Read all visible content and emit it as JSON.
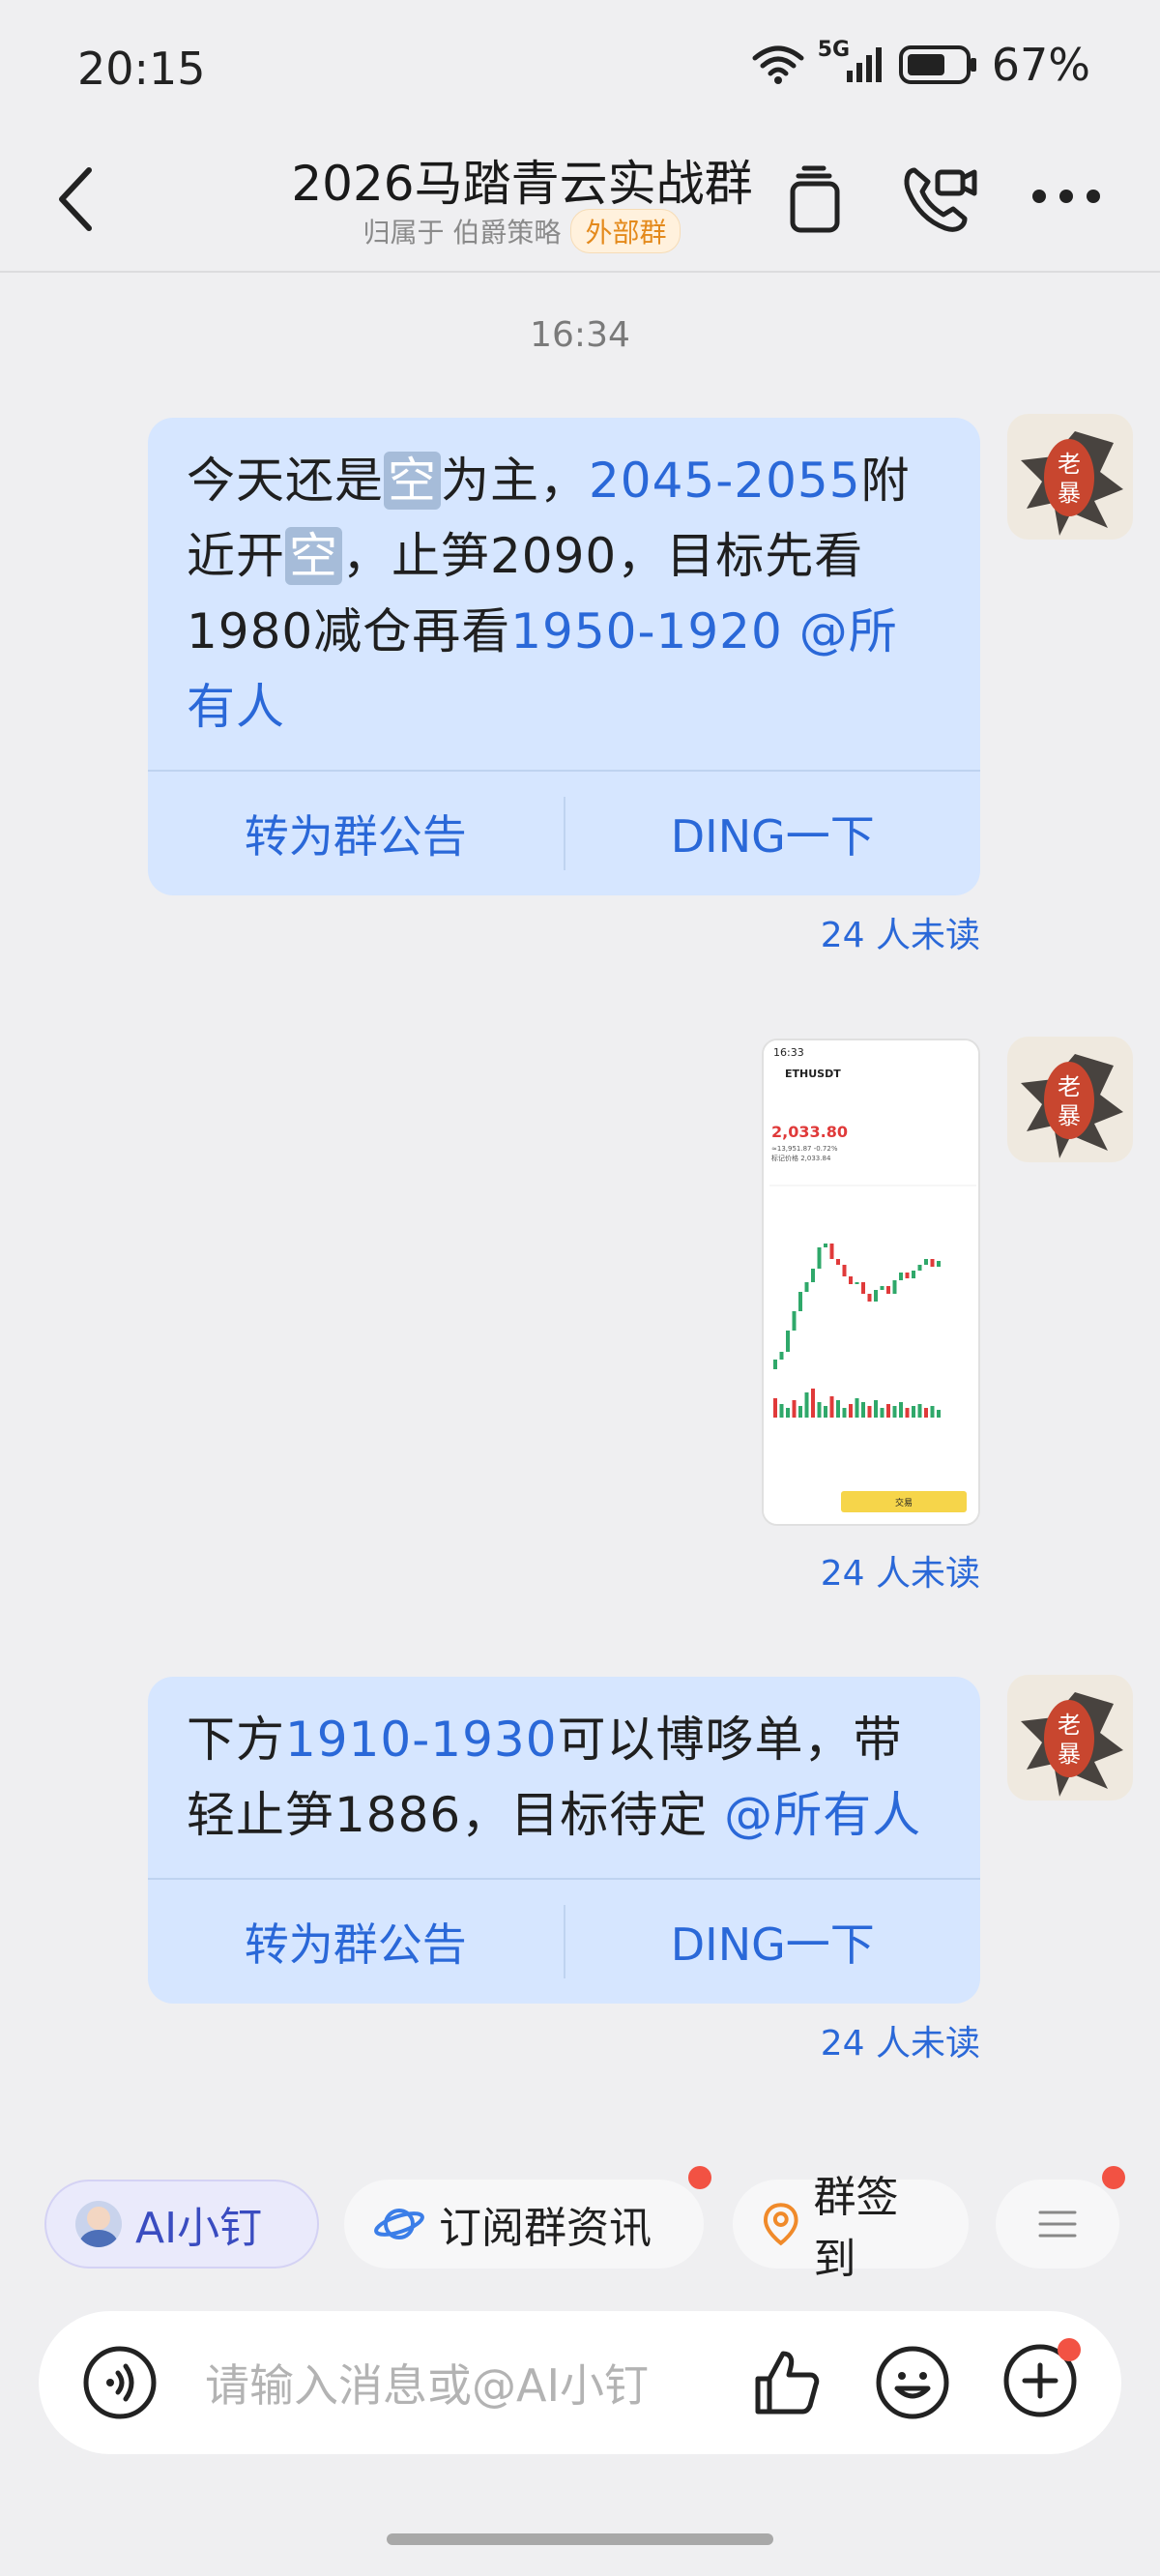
{
  "status_bar": {
    "time": "20:15",
    "network": "5G",
    "battery": "67%"
  },
  "header": {
    "title": "2026马踏青云实战群",
    "subtitle": "归属于 伯爵策略",
    "badge": "外部群",
    "icons": [
      "back-icon",
      "copy-icon",
      "video-call-icon",
      "more-icon"
    ]
  },
  "timestamp": "16:34",
  "messages": [
    {
      "segments": [
        {
          "t": "今天还是",
          "c": "n"
        },
        {
          "t": "空",
          "c": "tag"
        },
        {
          "t": "为主，",
          "c": "n"
        },
        {
          "t": "2045-2055",
          "c": "h"
        },
        {
          "t": "附近开",
          "c": "n"
        },
        {
          "t": "空",
          "c": "tag"
        },
        {
          "t": "，止笋2090，目标先看1980减仓再看",
          "c": "n"
        },
        {
          "t": "1950-1920",
          "c": "h"
        },
        {
          "t": " ",
          "c": "n"
        },
        {
          "t": "@所有人",
          "c": "h"
        }
      ],
      "action_left": "转为群公告",
      "action_right": "DING一下",
      "unread": "24 人未读"
    },
    {
      "image": "ETHUSDT chart screenshot",
      "unread": "24 人未读",
      "thumb": {
        "time": "16:33",
        "symbol": "ETHUSDT",
        "price": "2,033.80",
        "sub": "≈13,951.87  -0.72%",
        "mark": "标记价格 2,033.84",
        "trade_btn": "交易"
      }
    },
    {
      "segments": [
        {
          "t": "下方",
          "c": "n"
        },
        {
          "t": "1910-1930",
          "c": "h"
        },
        {
          "t": "可以博哆单，带轻止笋1886，目标待定",
          "c": "n"
        },
        {
          "t": " ",
          "c": "n"
        },
        {
          "t": "@所有人",
          "c": "h"
        }
      ],
      "action_left": "转为群公告",
      "action_right": "DING一下",
      "unread": "24 人未读"
    }
  ],
  "avatar": {
    "text": "老暴"
  },
  "quick_actions": [
    {
      "label": "AI小钉",
      "icon": "ai-avatar-icon"
    },
    {
      "label": "订阅群资讯",
      "icon": "planet-icon",
      "dot": true
    },
    {
      "label": "群签到",
      "icon": "location-icon"
    },
    {
      "label": "",
      "icon": "menu-icon",
      "dot": true
    }
  ],
  "input": {
    "placeholder": "请输入消息或@AI小钉"
  },
  "colors": {
    "accent": "#2a68d8",
    "bubble": "#d6e6ff",
    "badge": "#e48a1c",
    "dot": "#f25243"
  }
}
